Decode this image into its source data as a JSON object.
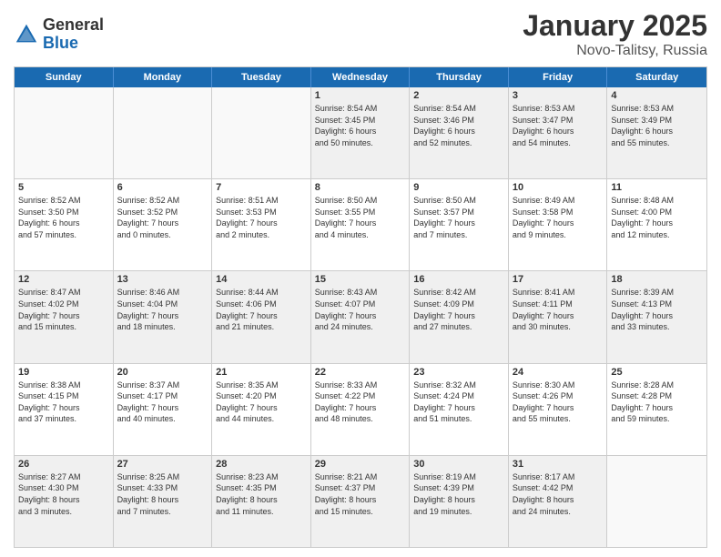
{
  "header": {
    "logo": {
      "general": "General",
      "blue": "Blue"
    },
    "title": "January 2025",
    "location": "Novo-Talitsy, Russia"
  },
  "calendar": {
    "days_of_week": [
      "Sunday",
      "Monday",
      "Tuesday",
      "Wednesday",
      "Thursday",
      "Friday",
      "Saturday"
    ],
    "weeks": [
      [
        {
          "day": "",
          "info": "",
          "empty": true
        },
        {
          "day": "",
          "info": "",
          "empty": true
        },
        {
          "day": "",
          "info": "",
          "empty": true
        },
        {
          "day": "1",
          "info": "Sunrise: 8:54 AM\nSunset: 3:45 PM\nDaylight: 6 hours\nand 50 minutes."
        },
        {
          "day": "2",
          "info": "Sunrise: 8:54 AM\nSunset: 3:46 PM\nDaylight: 6 hours\nand 52 minutes."
        },
        {
          "day": "3",
          "info": "Sunrise: 8:53 AM\nSunset: 3:47 PM\nDaylight: 6 hours\nand 54 minutes."
        },
        {
          "day": "4",
          "info": "Sunrise: 8:53 AM\nSunset: 3:49 PM\nDaylight: 6 hours\nand 55 minutes."
        }
      ],
      [
        {
          "day": "5",
          "info": "Sunrise: 8:52 AM\nSunset: 3:50 PM\nDaylight: 6 hours\nand 57 minutes."
        },
        {
          "day": "6",
          "info": "Sunrise: 8:52 AM\nSunset: 3:52 PM\nDaylight: 7 hours\nand 0 minutes."
        },
        {
          "day": "7",
          "info": "Sunrise: 8:51 AM\nSunset: 3:53 PM\nDaylight: 7 hours\nand 2 minutes."
        },
        {
          "day": "8",
          "info": "Sunrise: 8:50 AM\nSunset: 3:55 PM\nDaylight: 7 hours\nand 4 minutes."
        },
        {
          "day": "9",
          "info": "Sunrise: 8:50 AM\nSunset: 3:57 PM\nDaylight: 7 hours\nand 7 minutes."
        },
        {
          "day": "10",
          "info": "Sunrise: 8:49 AM\nSunset: 3:58 PM\nDaylight: 7 hours\nand 9 minutes."
        },
        {
          "day": "11",
          "info": "Sunrise: 8:48 AM\nSunset: 4:00 PM\nDaylight: 7 hours\nand 12 minutes."
        }
      ],
      [
        {
          "day": "12",
          "info": "Sunrise: 8:47 AM\nSunset: 4:02 PM\nDaylight: 7 hours\nand 15 minutes."
        },
        {
          "day": "13",
          "info": "Sunrise: 8:46 AM\nSunset: 4:04 PM\nDaylight: 7 hours\nand 18 minutes."
        },
        {
          "day": "14",
          "info": "Sunrise: 8:44 AM\nSunset: 4:06 PM\nDaylight: 7 hours\nand 21 minutes."
        },
        {
          "day": "15",
          "info": "Sunrise: 8:43 AM\nSunset: 4:07 PM\nDaylight: 7 hours\nand 24 minutes."
        },
        {
          "day": "16",
          "info": "Sunrise: 8:42 AM\nSunset: 4:09 PM\nDaylight: 7 hours\nand 27 minutes."
        },
        {
          "day": "17",
          "info": "Sunrise: 8:41 AM\nSunset: 4:11 PM\nDaylight: 7 hours\nand 30 minutes."
        },
        {
          "day": "18",
          "info": "Sunrise: 8:39 AM\nSunset: 4:13 PM\nDaylight: 7 hours\nand 33 minutes."
        }
      ],
      [
        {
          "day": "19",
          "info": "Sunrise: 8:38 AM\nSunset: 4:15 PM\nDaylight: 7 hours\nand 37 minutes."
        },
        {
          "day": "20",
          "info": "Sunrise: 8:37 AM\nSunset: 4:17 PM\nDaylight: 7 hours\nand 40 minutes."
        },
        {
          "day": "21",
          "info": "Sunrise: 8:35 AM\nSunset: 4:20 PM\nDaylight: 7 hours\nand 44 minutes."
        },
        {
          "day": "22",
          "info": "Sunrise: 8:33 AM\nSunset: 4:22 PM\nDaylight: 7 hours\nand 48 minutes."
        },
        {
          "day": "23",
          "info": "Sunrise: 8:32 AM\nSunset: 4:24 PM\nDaylight: 7 hours\nand 51 minutes."
        },
        {
          "day": "24",
          "info": "Sunrise: 8:30 AM\nSunset: 4:26 PM\nDaylight: 7 hours\nand 55 minutes."
        },
        {
          "day": "25",
          "info": "Sunrise: 8:28 AM\nSunset: 4:28 PM\nDaylight: 7 hours\nand 59 minutes."
        }
      ],
      [
        {
          "day": "26",
          "info": "Sunrise: 8:27 AM\nSunset: 4:30 PM\nDaylight: 8 hours\nand 3 minutes."
        },
        {
          "day": "27",
          "info": "Sunrise: 8:25 AM\nSunset: 4:33 PM\nDaylight: 8 hours\nand 7 minutes."
        },
        {
          "day": "28",
          "info": "Sunrise: 8:23 AM\nSunset: 4:35 PM\nDaylight: 8 hours\nand 11 minutes."
        },
        {
          "day": "29",
          "info": "Sunrise: 8:21 AM\nSunset: 4:37 PM\nDaylight: 8 hours\nand 15 minutes."
        },
        {
          "day": "30",
          "info": "Sunrise: 8:19 AM\nSunset: 4:39 PM\nDaylight: 8 hours\nand 19 minutes."
        },
        {
          "day": "31",
          "info": "Sunrise: 8:17 AM\nSunset: 4:42 PM\nDaylight: 8 hours\nand 24 minutes."
        },
        {
          "day": "",
          "info": "",
          "empty": true
        }
      ]
    ]
  }
}
